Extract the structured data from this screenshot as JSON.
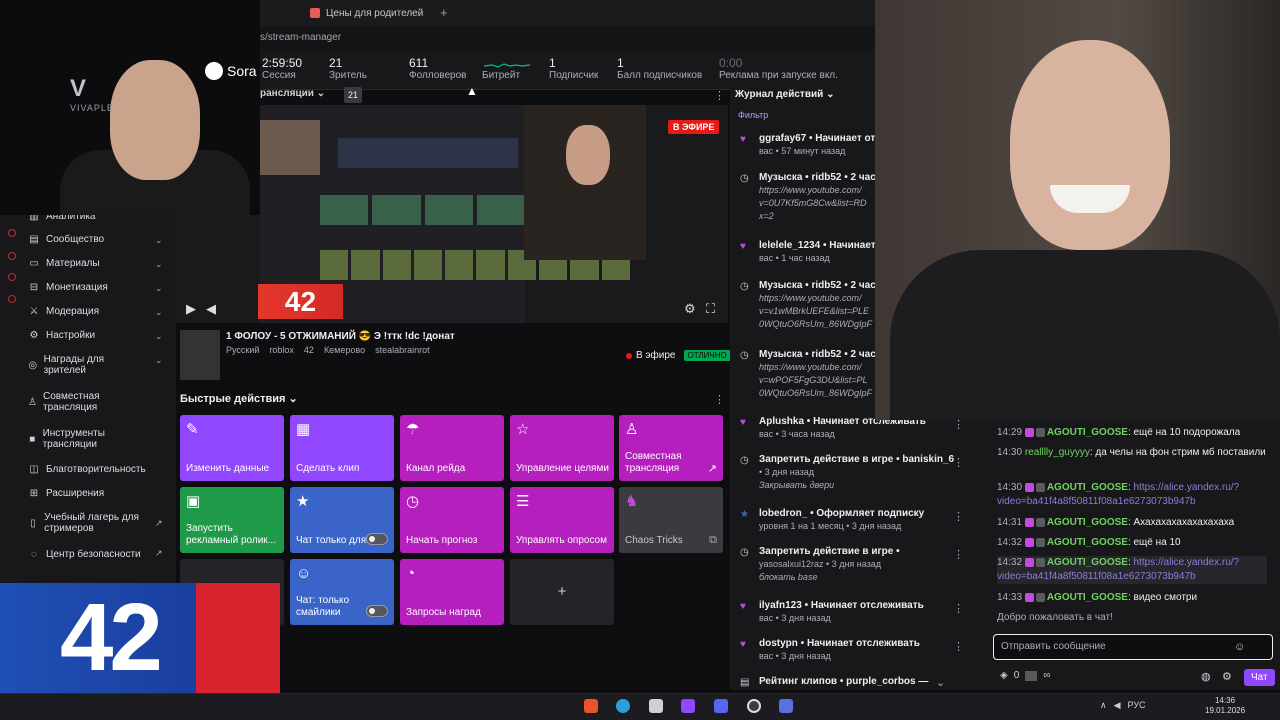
{
  "browser": {
    "tab_title": "Цены для родителей",
    "tab_plus": "+",
    "url": "s/stream-manager"
  },
  "stats": [
    {
      "value": "2:59:50",
      "label": "Сессия"
    },
    {
      "value": "21",
      "label": "Зритель"
    },
    {
      "value": "611",
      "label": "Фолловеров"
    },
    {
      "value": "",
      "label": "Битрейт"
    },
    {
      "value": "1",
      "label": "Подписчик"
    },
    {
      "value": "1",
      "label": "Балл подписчиков"
    },
    {
      "value": "0:00",
      "label": "Реклама при запуске вкл."
    }
  ],
  "preview": {
    "section_label": "рансляции",
    "viewer_badge": "21",
    "live_badge": "В ЭФИРЕ"
  },
  "stream_info": {
    "title": "1 ФОЛОУ - 5 ОТЖИМАНИЙ 😎 Э !ттк !dc !донат",
    "tags": [
      "Русский",
      "roblox",
      "42",
      "Кемерово",
      "stealabrainrot"
    ],
    "status_label": "В эфире",
    "status_badge": "ОТЛИЧНО"
  },
  "quick_actions": {
    "header": "Быстрые действия",
    "items": [
      {
        "label": "Изменить данные",
        "icon": "pencil-icon",
        "color": "#9147ff"
      },
      {
        "label": "Сделать клип",
        "icon": "clapper-icon",
        "color": "#9147ff"
      },
      {
        "label": "Канал рейда",
        "icon": "raid-icon",
        "color": "#b41fbd"
      },
      {
        "label": "Управление целями",
        "icon": "star-icon",
        "color": "#b41fbd"
      },
      {
        "label": "Совместная трансляция",
        "icon": "add-user-icon",
        "color": "#b41fbd"
      },
      {
        "label": "Запустить рекламный ролик...",
        "icon": "ad-icon",
        "color": "#1f9a4a"
      },
      {
        "label": "Чат только для...",
        "icon": "star-icon",
        "color": "#3a64c8"
      },
      {
        "label": "Начать прогноз",
        "icon": "prediction-icon",
        "color": "#b41fbd"
      },
      {
        "label": "Управлять опросом",
        "icon": "poll-icon",
        "color": "#b41fbd"
      },
      {
        "label": "Chaos Tricks",
        "icon": "chaos-icon",
        "color": "#3a3a3f"
      },
      {
        "label": "Чат: только смайлики",
        "icon": "smile-icon",
        "color": "#3a64c8"
      },
      {
        "label": "Запросы наград",
        "icon": "reward-icon",
        "color": "#b41fbd"
      },
      {
        "label": "+",
        "icon": "plus-icon",
        "color": "#242428"
      }
    ]
  },
  "left_nav": [
    {
      "label": "Аналитика"
    },
    {
      "label": "Сообщество"
    },
    {
      "label": "Материалы"
    },
    {
      "label": "Монетизация"
    },
    {
      "label": "Модерация"
    },
    {
      "label": "Настройки"
    },
    {
      "label": "Награды для зрителей"
    },
    {
      "label": "Совместная трансляция"
    },
    {
      "label": "Инструменты трансляции"
    },
    {
      "label": "Благотворительность"
    },
    {
      "label": "Расширения"
    },
    {
      "label": "Учебный лагерь для стримеров"
    },
    {
      "label": "Центр безопасности"
    }
  ],
  "overlay": {
    "cam_logo": "V",
    "cam_brand": "VIVAPLE",
    "sora_label": "Sora",
    "big_number": "42",
    "small_number": "42"
  },
  "activity": {
    "header": "Журнал действий",
    "filter": "Фильтр",
    "items": [
      {
        "icon": "heart-icon",
        "text": "ggrafay67 • Начинает от",
        "sub": "вас • 57 минут назад",
        "extra": ""
      },
      {
        "icon": "music-icon",
        "text": "Музыска • ridb52 • 2 час",
        "sub": "",
        "extra": "https://www.youtube.com/ v=0U7Kf5mG8Cw&list=RD x=2"
      },
      {
        "icon": "heart-icon",
        "text": "lelelele_1234 • Начинает",
        "sub": "вас • 1 час назад",
        "extra": ""
      },
      {
        "icon": "music-icon",
        "text": "Музыска • ridb52 • 2 час",
        "sub": "",
        "extra": "https://www.youtube.com/ v=v1wMBrkUEFE&list=PLE 0WQtuO6RsUm_86WDgIpF"
      },
      {
        "icon": "music-icon",
        "text": "Музыска • ridb52 • 2 час",
        "sub": "",
        "extra": "https://www.youtube.com/ v=wPOF5FgG3DU&list=PL 0WQtuO6RsUm_86WDgIpF"
      },
      {
        "icon": "heart-icon",
        "text": "Aplushka • Начинает отслеживать",
        "sub": "вас • 3 часа назад",
        "extra": ""
      },
      {
        "icon": "ban-icon",
        "text": "Запретить действие в игре • baniskin_6",
        "sub": "• 3 дня назад",
        "extra": "Закрывать двери"
      },
      {
        "icon": "star-icon",
        "text": "lobedron_ • Оформляет подписку",
        "sub": "уровня 1 на 1 месяц • 3 дня назад",
        "extra": ""
      },
      {
        "icon": "ban-icon",
        "text": "Запретить действие в игре •",
        "sub": "yasosalxui12raz • 3 дня назад",
        "extra": "блокать base"
      },
      {
        "icon": "heart-icon",
        "text": "ilyafn123 • Начинает отслеживать",
        "sub": "вас • 3 дня назад",
        "extra": ""
      },
      {
        "icon": "heart-icon",
        "text": "dostypn • Начинает отслеживать",
        "sub": "вас • 3 дня назад",
        "extra": ""
      },
      {
        "icon": "clips-icon",
        "text": "Рейтинг клипов • purple_corbos —",
        "sub": "",
        "extra": ""
      }
    ]
  },
  "chat": {
    "messages": [
      {
        "time": "14:29",
        "user": "AGOUTI_GOOSE",
        "text": "ещё на 10 подорожала",
        "link": ""
      },
      {
        "time": "14:30",
        "user": "realllly_guyyyy",
        "text": "да челы на фон стрим мб поставили",
        "link": ""
      },
      {
        "time": "14:30",
        "user": "AGOUTI_GOOSE",
        "text": "",
        "link": "https://alice.yandex.ru/?video=ba41f4a8f50811f08a1e6273073b947b"
      },
      {
        "time": "14:31",
        "user": "AGOUTI_GOOSE",
        "text": "Ахахахахахахахахаха",
        "link": ""
      },
      {
        "time": "14:32",
        "user": "AGOUTI_GOOSE",
        "text": "ещё на 10",
        "link": ""
      },
      {
        "time": "14:32",
        "user": "AGOUTI_GOOSE",
        "text": "",
        "link": "https://alice.yandex.ru/?video=ba41f4a8f50811f08a1e6273073b947b"
      },
      {
        "time": "14:33",
        "user": "AGOUTI_GOOSE",
        "text": "видео смотри",
        "link": ""
      }
    ],
    "welcome": "Добро пожаловать в чат!",
    "input_placeholder": "Отправить сообщение",
    "points": "0",
    "send_label": "Чат"
  },
  "taskbar": {
    "lang": "РУС",
    "time": "14:36",
    "date": "19.01.2026"
  }
}
